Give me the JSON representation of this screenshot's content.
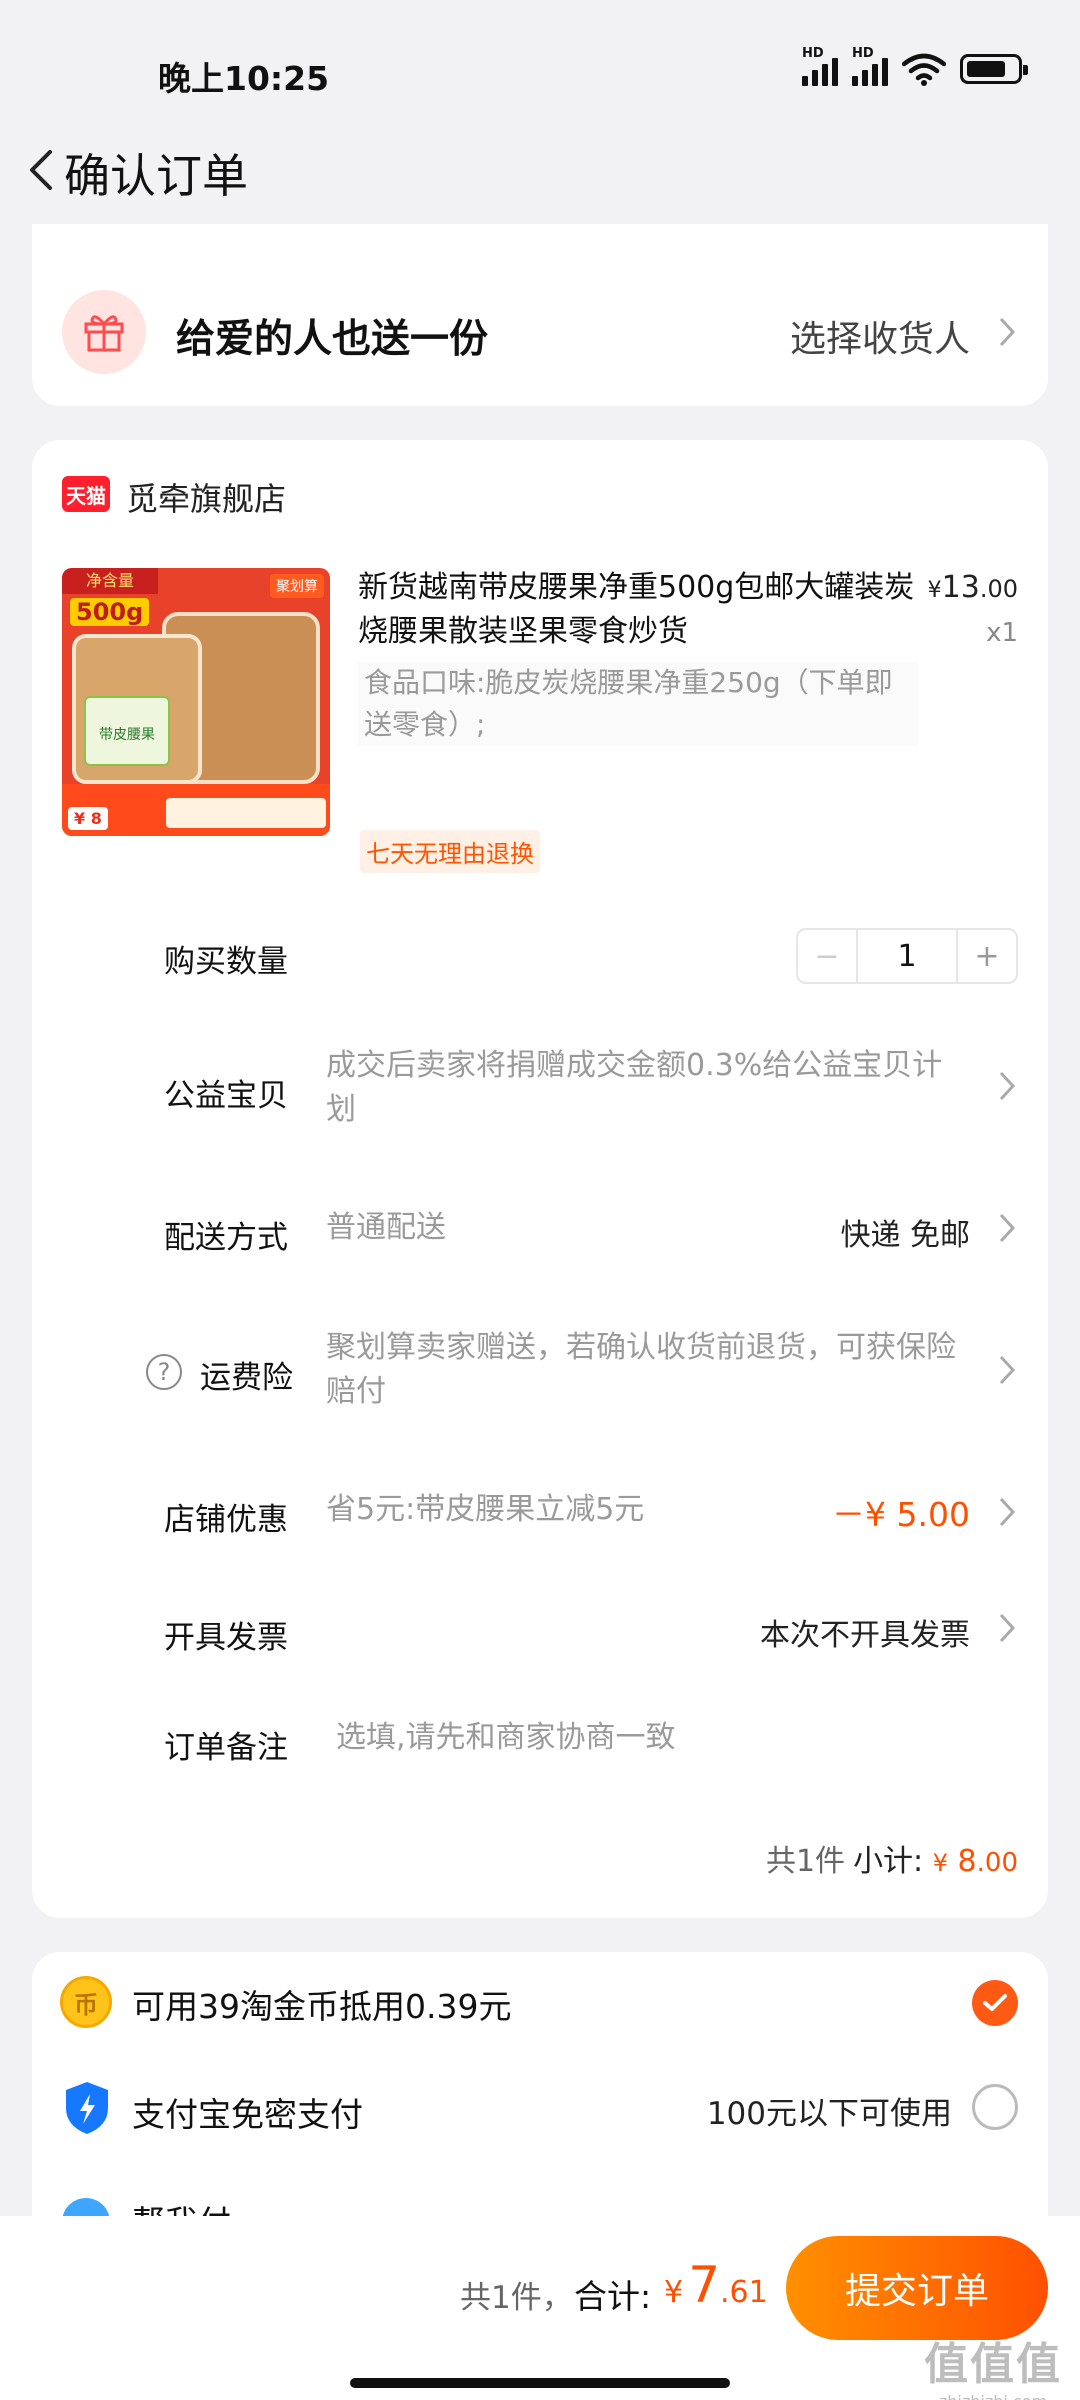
{
  "status_bar": {
    "time": "晚上10:25",
    "hd1": "HD",
    "hd2": "HD"
  },
  "header": {
    "title": "确认订单"
  },
  "gift": {
    "title": "给爱的人也送一份",
    "action": "选择收货人"
  },
  "shop": {
    "badge": "天猫",
    "name": "觅牵旗舰店",
    "product": {
      "title": "新货越南带皮腰果净重500g包邮大罐装炭烧腰果散装坚果零食炒货",
      "price_symbol": "¥",
      "price_int": "13",
      "price_dec": ".00",
      "quantity": "x1",
      "spec": "食品口味:脆皮炭烧腰果净重250g（下单即送零食）;",
      "return_tag": "七天无理由退换",
      "image": {
        "top_label": "净含量",
        "weight": "500g",
        "promo_tag": "聚划算",
        "jar_label": "带皮腰果",
        "price_badge": "¥ 8"
      }
    },
    "rows": {
      "quantity": {
        "label": "购买数量",
        "value": "1",
        "minus": "−",
        "plus": "+"
      },
      "charity": {
        "label": "公益宝贝",
        "value": "成交后卖家将捐赠成交金额0.3%给公益宝贝计划"
      },
      "delivery": {
        "label": "配送方式",
        "value": "普通配送",
        "right": "快递 免邮"
      },
      "insurance": {
        "label": "运费险",
        "help": "?",
        "value": "聚划算卖家赠送，若确认收货前退货，可获保险赔付"
      },
      "discount": {
        "label": "店铺优惠",
        "value": "省5元:带皮腰果立减5元",
        "right": "－¥ 5.00"
      },
      "invoice": {
        "label": "开具发票",
        "right": "本次不开具发票"
      },
      "note": {
        "label": "订单备注",
        "placeholder": "选填,请先和商家协商一致"
      }
    },
    "subtotal": {
      "count": "共1件",
      "label": "小计:",
      "symbol": "¥",
      "int": "8",
      "dec": ".00"
    }
  },
  "payment": {
    "coin": {
      "label": "可用39淘金币抵用0.39元",
      "checked": true,
      "icon_char": "币"
    },
    "alipay": {
      "label": "支付宝免密支付",
      "note": "100元以下可使用",
      "checked": false
    },
    "help_pay": {
      "label": "帮我付"
    }
  },
  "footer": {
    "count": "共1件，",
    "total_label": "合计:",
    "symbol": "¥",
    "int": "7",
    "dec": ".61",
    "submit": "提交订单",
    "watermark": "值值值",
    "watermark_url": "zhizhizhi.com"
  },
  "colors": {
    "accent": "#ff5000",
    "tmall": "#ff1f2d",
    "page_bg": "#f2f2f4"
  }
}
